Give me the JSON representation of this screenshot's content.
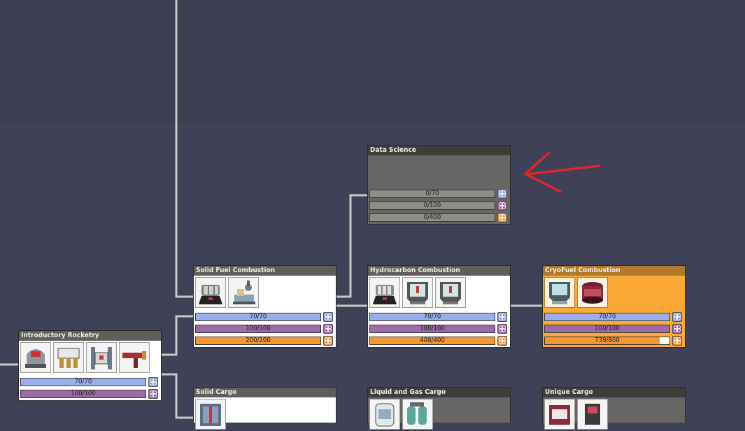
{
  "nodes": {
    "data_science": {
      "title": "Data Science",
      "bars": [
        "0/70",
        "0/100",
        "0/400"
      ]
    },
    "solid_fuel": {
      "title": "Solid Fuel Combustion",
      "bars": [
        "70/70",
        "100/100",
        "200/200"
      ]
    },
    "hydrocarbon": {
      "title": "Hydrocarbon Combustion",
      "bars": [
        "70/70",
        "100/100",
        "400/400"
      ]
    },
    "cryofuel": {
      "title": "CryoFuel Combustion",
      "bars": [
        "70/70",
        "100/100",
        "739/800"
      ],
      "progress": 0.924
    },
    "intro_rocketry": {
      "title": "Introductory Rocketry",
      "bars": [
        "70/70",
        "100/100"
      ]
    },
    "solid_cargo": {
      "title": "Solid Cargo"
    },
    "liquid_gas_cargo": {
      "title": "Liquid and Gas Cargo"
    },
    "unique_cargo": {
      "title": "Unique Cargo"
    }
  },
  "research_types": [
    "basic-research-icon",
    "advanced-research-icon",
    "interstellar-research-icon"
  ],
  "colors": {
    "background": "#3f4157",
    "done_node": "#ffffff",
    "locked_node": "#686664",
    "active_node": "#fcaa36",
    "basic_research": "#9cadec",
    "advanced_research": "#9e6aa8",
    "interstellar_research": "#f6962e",
    "annotation_arrow": "#e0252a"
  }
}
